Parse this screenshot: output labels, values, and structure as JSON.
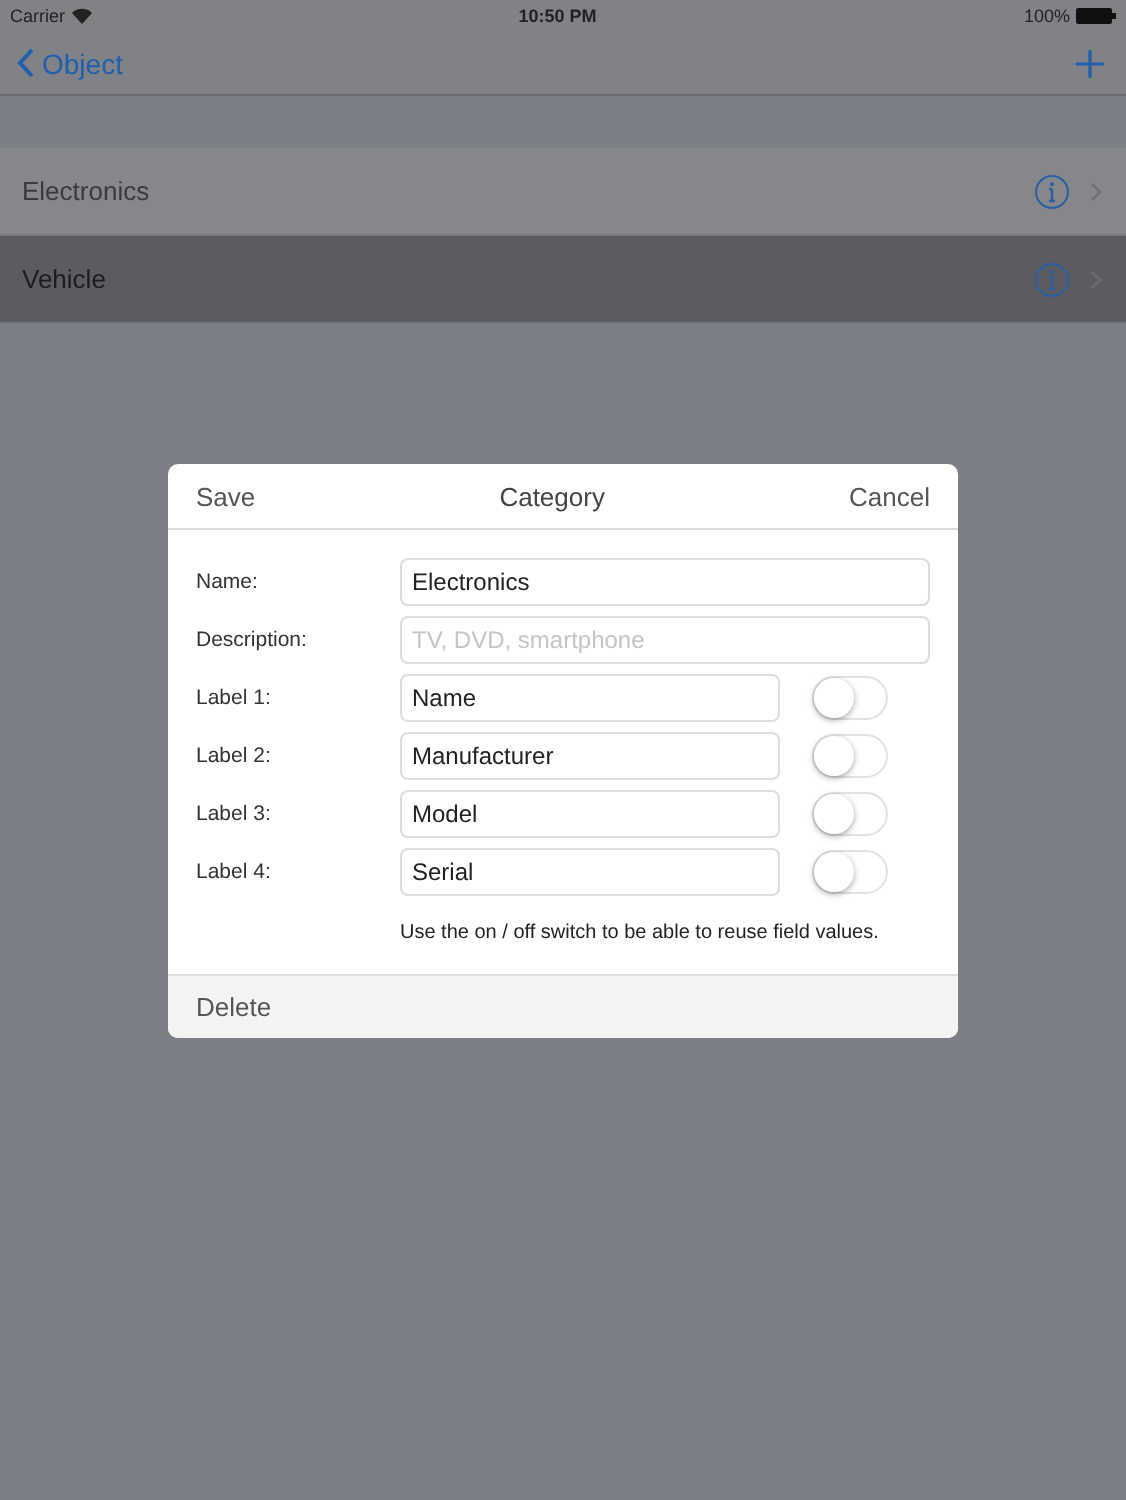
{
  "status_bar": {
    "carrier": "Carrier",
    "time": "10:50 PM",
    "battery": "100%"
  },
  "nav": {
    "back": "Object"
  },
  "list": [
    {
      "label": "Electronics",
      "selected": false
    },
    {
      "label": "Vehicle",
      "selected": true
    }
  ],
  "dialog": {
    "left_button": "Save",
    "title": "Category",
    "right_button": "Cancel",
    "fields": [
      {
        "kind": "text",
        "label": "Name:",
        "value": "Electronics"
      },
      {
        "kind": "text",
        "label": "Description:",
        "placeholder": "TV, DVD, smartphone"
      },
      {
        "kind": "switch",
        "label": "Label 1:",
        "value": "Name",
        "on": false
      },
      {
        "kind": "switch",
        "label": "Label 2:",
        "value": "Manufacturer",
        "on": false
      },
      {
        "kind": "switch",
        "label": "Label 3:",
        "value": "Model",
        "on": false
      },
      {
        "kind": "switch",
        "label": "Label 4:",
        "value": "Serial",
        "on": false
      }
    ],
    "hint": "Use the on / off switch to be able to reuse field values.",
    "footer_button": "Delete"
  }
}
